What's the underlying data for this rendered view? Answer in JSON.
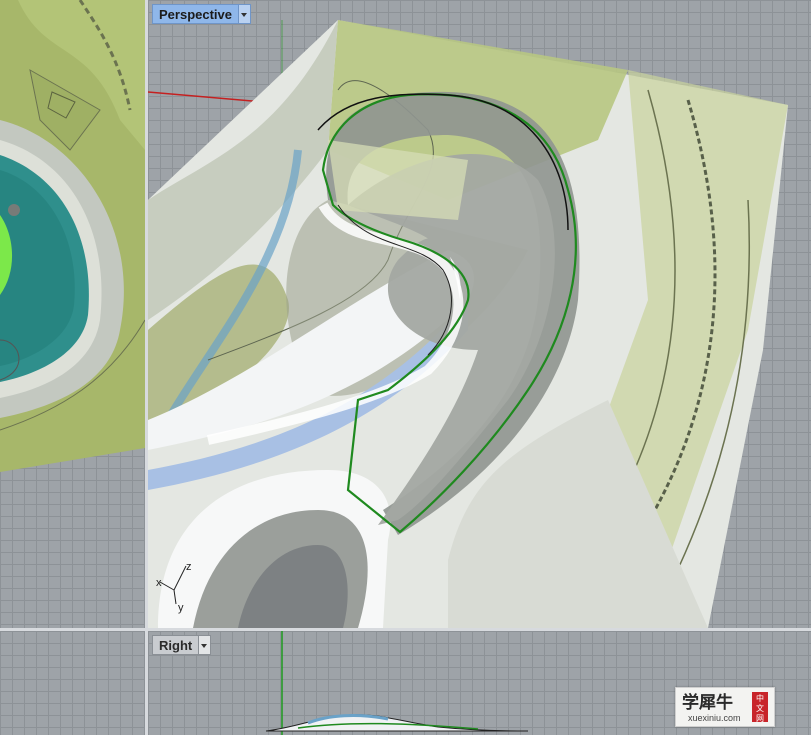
{
  "viewports": {
    "perspective": {
      "title": "Perspective",
      "active": true
    },
    "right": {
      "title": "Right",
      "active": false
    }
  },
  "axes": {
    "z": "z",
    "y": "y",
    "x": "x"
  },
  "watermark": {
    "cn": "学犀牛",
    "url": "xuexiniu.com",
    "tag": [
      "中",
      "文",
      "网"
    ]
  },
  "colors": {
    "active_tab": "#8fb7ea",
    "inactive_tab": "#c9ccd0",
    "curve": "#1f8a1f",
    "grid": "#9ea3a8"
  }
}
